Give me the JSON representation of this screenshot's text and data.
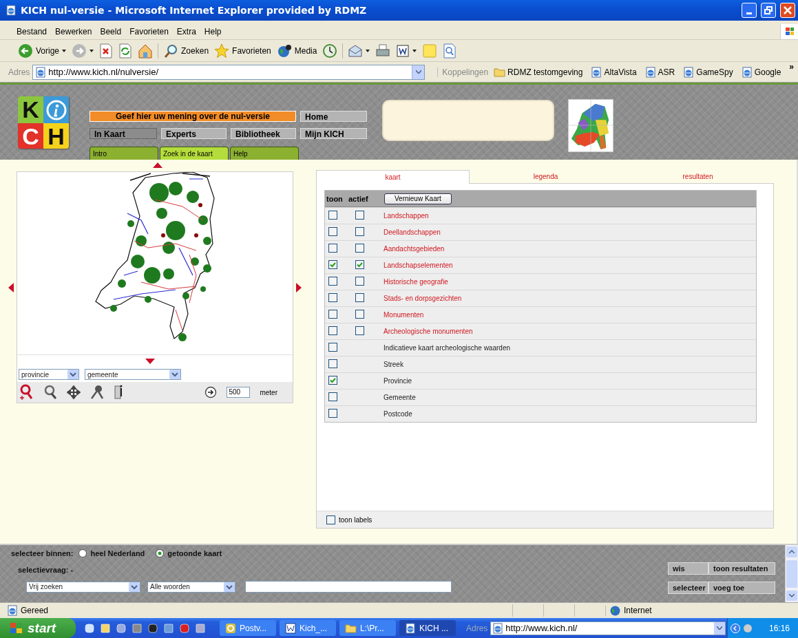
{
  "window": {
    "title": "KICH nul-versie - Microsoft Internet Explorer provided by RDMZ"
  },
  "menu": [
    "Bestand",
    "Bewerken",
    "Beeld",
    "Favorieten",
    "Extra",
    "Help"
  ],
  "toolbar": [
    {
      "kind": "back",
      "label": "Vorige",
      "dropdown": true
    },
    {
      "kind": "forward",
      "dropdown": true
    },
    {
      "kind": "stop"
    },
    {
      "kind": "refresh"
    },
    {
      "kind": "home"
    },
    {
      "kind": "search",
      "label": "Zoeken"
    },
    {
      "kind": "favorites",
      "label": "Favorieten"
    },
    {
      "kind": "media",
      "label": "Media"
    },
    {
      "kind": "history"
    },
    {
      "kind": "mail",
      "dropdown": true
    },
    {
      "kind": "print"
    },
    {
      "kind": "word",
      "dropdown": true
    },
    {
      "kind": "note"
    },
    {
      "kind": "research"
    }
  ],
  "address_bar": {
    "label": "Adres",
    "url": "http://www.kich.nl/nulversie/",
    "links_label": "Koppelingen",
    "more": "»",
    "links": [
      {
        "kind": "folder",
        "label": "RDMZ testomgeving"
      },
      {
        "kind": "page",
        "label": "AltaVista"
      },
      {
        "kind": "page",
        "label": "ASR"
      },
      {
        "kind": "page",
        "label": "GameSpy"
      },
      {
        "kind": "page",
        "label": "Google"
      }
    ]
  },
  "site": {
    "logo": {
      "letters": [
        "K",
        "C",
        "H"
      ]
    },
    "banner": "Geef hier uw mening over de nul-versie",
    "nav": [
      {
        "label": "In Kaart",
        "selected": true
      },
      {
        "label": "Experts",
        "selected": false
      },
      {
        "label": "Bibliotheek",
        "selected": false
      }
    ],
    "side_nav": [
      "Home",
      "Mijn KICH"
    ],
    "subtabs": [
      {
        "label": "Intro",
        "selected": false
      },
      {
        "label": "Zoek in de kaart",
        "selected": true
      },
      {
        "label": "Help",
        "selected": false
      }
    ],
    "map": {
      "selects": [
        "provincie",
        "gemeente"
      ],
      "scale": "500",
      "unit": "meter"
    },
    "tabs": [
      {
        "label": "kaart",
        "selected": true
      },
      {
        "label": "legenda",
        "selected": false
      },
      {
        "label": "resultaten",
        "selected": false
      }
    ],
    "layers": {
      "columns": [
        "toon",
        "actief"
      ],
      "button": "Vernieuw Kaart",
      "rows": [
        {
          "kind": "theme",
          "name": "Landschappen",
          "toon": false,
          "actief": false
        },
        {
          "kind": "theme",
          "name": "Deellandschappen",
          "toon": false,
          "actief": false
        },
        {
          "kind": "theme",
          "name": "Aandachtsgebieden",
          "toon": false,
          "actief": false
        },
        {
          "kind": "theme",
          "name": "Landschapselementen",
          "toon": true,
          "actief": true
        },
        {
          "kind": "theme",
          "name": "Historische geografie",
          "toon": false,
          "actief": false
        },
        {
          "kind": "theme",
          "name": "Stads- en dorpsgezichten",
          "toon": false,
          "actief": false
        },
        {
          "kind": "theme",
          "name": "Monumenten",
          "toon": false,
          "actief": false
        },
        {
          "kind": "theme",
          "name": "Archeologische monumenten",
          "toon": false,
          "actief": false
        },
        {
          "kind": "base",
          "name": "Indicatieve kaart archeologische waarden",
          "toon": false
        },
        {
          "kind": "base",
          "name": "Streek",
          "toon": false
        },
        {
          "kind": "base",
          "name": "Provincie",
          "toon": true
        },
        {
          "kind": "base",
          "name": "Gemeente",
          "toon": false
        },
        {
          "kind": "base",
          "name": "Postcode",
          "toon": false
        }
      ]
    },
    "labels_toggle": {
      "label": "toon labels",
      "checked": false
    },
    "search": {
      "scope_label": "selecteer binnen:",
      "scopes": [
        {
          "label": "heel Nederland",
          "selected": false
        },
        {
          "label": "getoonde kaart",
          "selected": true
        }
      ],
      "query_label": "selectievraag: -",
      "selects": [
        "Vrij zoeken",
        "Alle woorden"
      ],
      "buttons": [
        [
          "wis",
          "toon resultaten"
        ],
        [
          "selecteer",
          "voeg toe"
        ]
      ]
    }
  },
  "status_bar": {
    "text": "Gereed",
    "zone": "Internet"
  },
  "taskbar": {
    "start": "start",
    "tasks": [
      {
        "kind": "app",
        "label": "Postv...",
        "selected": false
      },
      {
        "kind": "word",
        "label": "Kich_...",
        "selected": false
      },
      {
        "kind": "folder",
        "label": "L:\\Pr...",
        "selected": false
      },
      {
        "kind": "ie",
        "label": "KICH ...",
        "selected": true
      }
    ],
    "address_label": "Adres",
    "address": "http://www.kich.nl/",
    "clock": "16:16"
  }
}
